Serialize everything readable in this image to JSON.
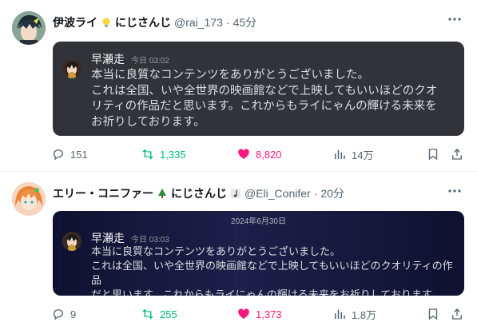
{
  "posts": [
    {
      "author": {
        "display_name": "伊波ライ",
        "emoji_1": "lightbulb-emoji",
        "suffix": "にじさんじ",
        "handle": "@rai_173",
        "time": "45分"
      },
      "embed": {
        "date": "",
        "author": "早瀬走",
        "time": "今日 03:02",
        "lines": [
          "本当に良質なコンテンツをありがとうございました。",
          "これは全国、いや全世界の映画館などで上映してもいいほどのクオ",
          "リティの作品だと思います。これからもライにゃんの輝ける未来を",
          "お祈りしております。"
        ]
      },
      "actions": {
        "replies": "151",
        "reposts": "1,335",
        "likes": "8,820",
        "views": "14万"
      }
    },
    {
      "author": {
        "display_name": "エリー・コニファー",
        "emoji_1": "tree-emoji",
        "suffix": "にじさんじ",
        "emoji_2": "music-note-emoji",
        "handle": "@Eli_Conifer",
        "time": "20分"
      },
      "embed": {
        "date": "2024年6月30日",
        "author": "早瀬走",
        "time": "今日 03:03",
        "lines": [
          "本当に良質なコンテンツをありがとうございました。",
          "これは全国、いや全世界の映画館などで上映してもいいほどのクオリティの作品",
          "だと思います。これからもライにゃんの輝ける未来をお祈りしております。"
        ]
      },
      "actions": {
        "replies": "9",
        "reposts": "255",
        "likes": "1,373",
        "views": "1.8万"
      }
    }
  ],
  "colors": {
    "repost_green": "#00ba7c",
    "like_pink": "#f91880",
    "muted": "#536471",
    "discord_dark": "#313338",
    "discord_navy": "#0f1130"
  },
  "icons": {
    "reply": "reply-icon",
    "repost": "repost-icon",
    "like": "heart-icon",
    "views": "views-icon",
    "bookmark": "bookmark-icon",
    "share": "share-icon",
    "more": "more-icon"
  }
}
